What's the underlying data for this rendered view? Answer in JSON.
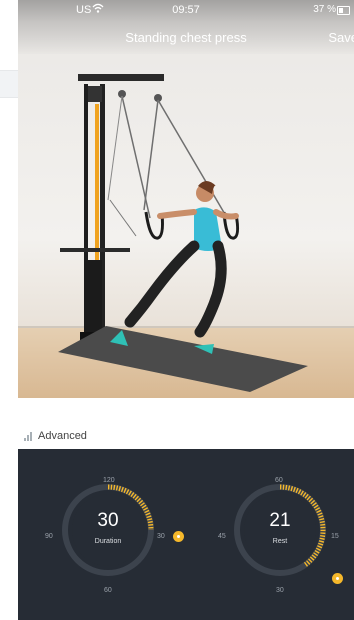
{
  "status_bar": {
    "carrier": "US",
    "time": "09:57",
    "battery": "37 %"
  },
  "nav": {
    "title": "Standing chest press",
    "save": "Save"
  },
  "difficulty": {
    "label": "Advanced"
  },
  "duration_dial": {
    "value": "30",
    "label": "Duration",
    "ticks": {
      "top": "120",
      "left": "90",
      "right": "30",
      "bottom": "60"
    }
  },
  "rest_dial": {
    "value": "21",
    "label": "Rest",
    "ticks": {
      "top": "60",
      "left": "45",
      "right": "15",
      "bottom": "30"
    }
  },
  "colors": {
    "panel": "#262c35",
    "accent": "#f5b82b",
    "track": "#3c434d"
  }
}
